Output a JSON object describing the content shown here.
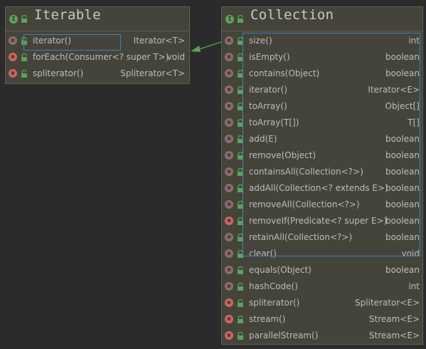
{
  "iterable": {
    "type_icon": "I",
    "title": "Iterable",
    "methods": [
      {
        "name": "iterator()",
        "type": "Iterator<T>",
        "icon": "m",
        "abstract": true
      },
      {
        "name": "forEach(Consumer<? super T>)",
        "type": "void",
        "icon": "m",
        "abstract": false
      },
      {
        "name": "spliterator()",
        "type": "Spliterator<T>",
        "icon": "m",
        "abstract": false
      }
    ]
  },
  "collection": {
    "type_icon": "I",
    "title": "Collection",
    "methods": [
      {
        "name": "size()",
        "type": "int",
        "icon": "m",
        "abstract": true
      },
      {
        "name": "isEmpty()",
        "type": "boolean",
        "icon": "m",
        "abstract": true
      },
      {
        "name": "contains(Object)",
        "type": "boolean",
        "icon": "m",
        "abstract": true
      },
      {
        "name": "iterator()",
        "type": "Iterator<E>",
        "icon": "m",
        "abstract": true
      },
      {
        "name": "toArray()",
        "type": "Object[]",
        "icon": "m",
        "abstract": true
      },
      {
        "name": "toArray(T[])",
        "type": "T[]",
        "icon": "m",
        "abstract": true
      },
      {
        "name": "add(E)",
        "type": "boolean",
        "icon": "m",
        "abstract": true
      },
      {
        "name": "remove(Object)",
        "type": "boolean",
        "icon": "m",
        "abstract": true
      },
      {
        "name": "containsAll(Collection<?>)",
        "type": "boolean",
        "icon": "m",
        "abstract": true
      },
      {
        "name": "addAll(Collection<? extends E>)",
        "type": "boolean",
        "icon": "m",
        "abstract": true
      },
      {
        "name": "removeAll(Collection<?>)",
        "type": "boolean",
        "icon": "m",
        "abstract": true
      },
      {
        "name": "removeIf(Predicate<? super E>)",
        "type": "boolean",
        "icon": "m",
        "abstract": false
      },
      {
        "name": "retainAll(Collection<?>)",
        "type": "boolean",
        "icon": "m",
        "abstract": true
      },
      {
        "name": "clear()",
        "type": "void",
        "icon": "m",
        "abstract": true
      },
      {
        "name": "equals(Object)",
        "type": "boolean",
        "icon": "m",
        "abstract": true
      },
      {
        "name": "hashCode()",
        "type": "int",
        "icon": "m",
        "abstract": true
      },
      {
        "name": "spliterator()",
        "type": "Spliterator<E>",
        "icon": "m",
        "abstract": false
      },
      {
        "name": "stream()",
        "type": "Stream<E>",
        "icon": "m",
        "abstract": false
      },
      {
        "name": "parallelStream()",
        "type": "Stream<E>",
        "icon": "m",
        "abstract": false
      }
    ]
  },
  "relation": {
    "from": "Collection",
    "to": "Iterable",
    "kind": "extends"
  },
  "colors": {
    "background": "#2b2b2b",
    "box_fill": "#45443a",
    "box_border": "#5f5f57",
    "text": "#bdbdb8",
    "interface_icon": "#62a05a",
    "method_icon": "#cc6666",
    "public_green": "#5fa05a",
    "selection_blue": "#3d7fc1",
    "arrow_green": "#5fa05a"
  }
}
